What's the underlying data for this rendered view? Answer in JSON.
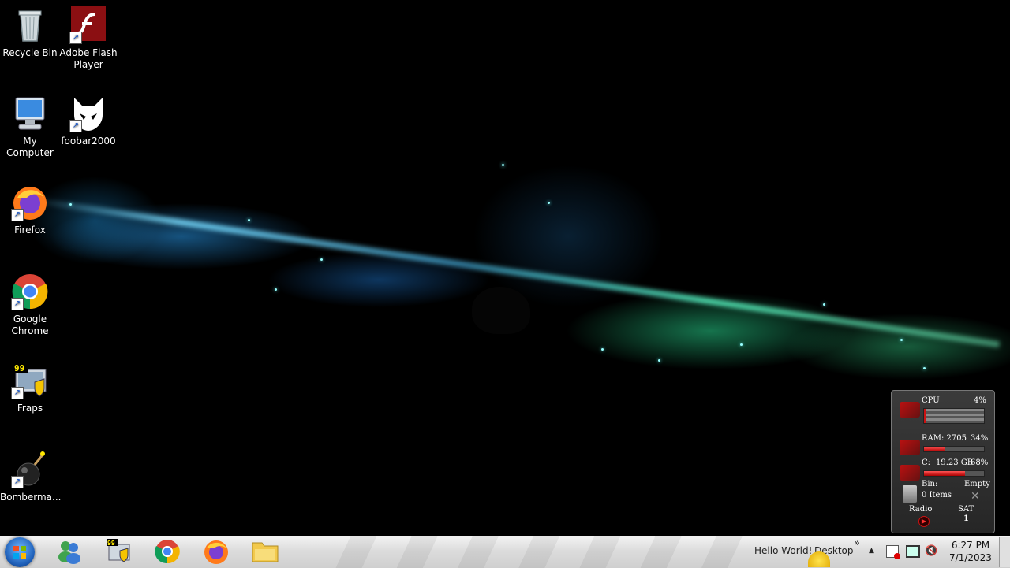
{
  "desktop": {
    "icons": [
      {
        "label_line1": "Recycle Bin",
        "label_line2": "",
        "icon": "recycle-bin-icon"
      },
      {
        "label_line1": "Adobe Flash",
        "label_line2": "Player",
        "icon": "flash-player-icon"
      },
      {
        "label_line1": "My",
        "label_line2": "Computer",
        "icon": "computer-icon"
      },
      {
        "label_line1": "foobar2000",
        "label_line2": "",
        "icon": "foobar-icon"
      },
      {
        "label_line1": "Firefox",
        "label_line2": "",
        "icon": "firefox-icon"
      },
      {
        "label_line1": "Google",
        "label_line2": "Chrome",
        "icon": "chrome-icon"
      },
      {
        "label_line1": "Fraps",
        "label_line2": "",
        "icon": "fraps-icon"
      },
      {
        "label_line1": "Bomberma...",
        "label_line2": "",
        "icon": "bomb-icon"
      }
    ],
    "shortcut_arrow": "↗"
  },
  "gadget": {
    "cpu_label": "CPU",
    "cpu_value": "4%",
    "cpu_fraction": 0.04,
    "ram_label": "RAM: 2705",
    "ram_value": "34%",
    "ram_fraction": 0.34,
    "disk_label": "C:",
    "disk_size": "19.23 GB",
    "disk_value": "68%",
    "disk_fraction": 0.68,
    "bin_label": "Bin:",
    "bin_status": "Empty",
    "bin_items": "0 Items",
    "radio_label": "Radio",
    "day": "SAT",
    "date_num": "1"
  },
  "taskbar": {
    "pinned": [
      "messenger-icon",
      "fraps-icon",
      "chrome-icon",
      "firefox-icon",
      "folder-icon"
    ],
    "toolbar_text": "Hello World!",
    "desktop_toolbar": "Desktop",
    "chevron": "»",
    "clock_time": "6:27 PM",
    "clock_date": "7/1/2023"
  },
  "colors": {
    "taskbar_bg": "#dcdcdc",
    "gadget_accent": "#cc1111"
  }
}
